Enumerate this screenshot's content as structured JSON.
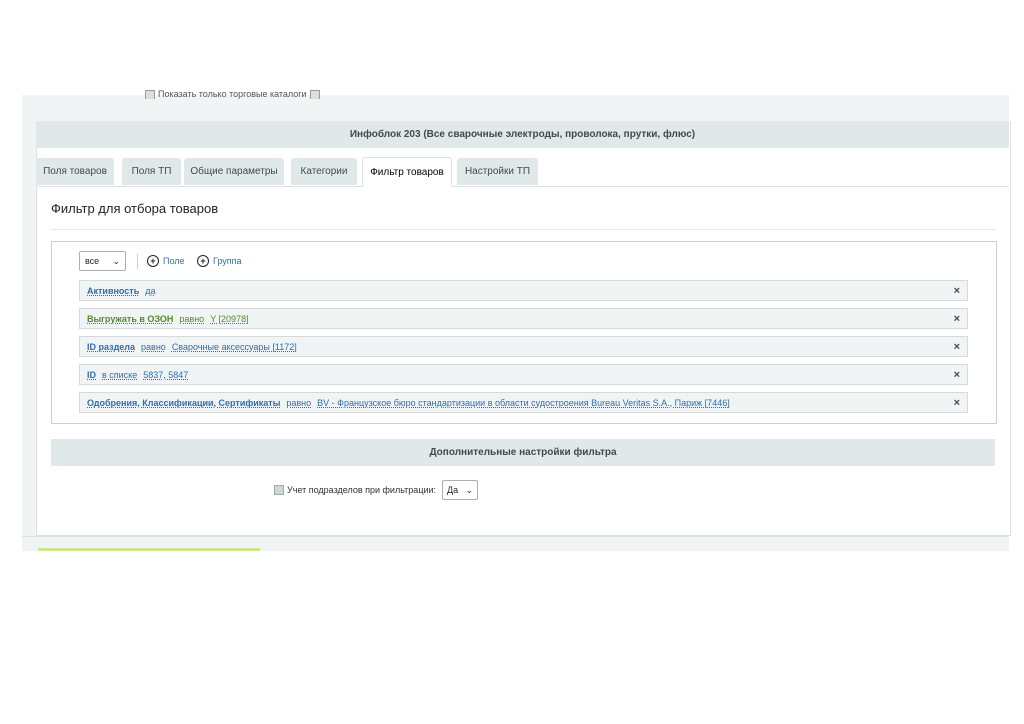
{
  "top_note": {
    "text": "Показать только торговые каталоги"
  },
  "iblock_header": "Инфоблок 203 (Все сварочные электроды, проволока, прутки, флюс)",
  "tabs": [
    {
      "label": "Поля товаров"
    },
    {
      "label": "Поля ТП"
    },
    {
      "label": "Общие параметры"
    },
    {
      "label": "Категории"
    },
    {
      "label": "Фильтр товаров",
      "active": true
    },
    {
      "label": "Настройки ТП"
    }
  ],
  "page_title": "Фильтр для отбора товаров",
  "filter": {
    "logic_value": "все",
    "add_field": "Поле",
    "add_group": "Группа",
    "conditions": [
      {
        "field": "Активность",
        "op": "",
        "value": "да",
        "color": "blue"
      },
      {
        "field": "Выгружать в ОЗОН",
        "op": "равно",
        "value": "Y [20978]",
        "color": "green"
      },
      {
        "field": "ID раздела",
        "op": "равно",
        "value": "Сварочные аксессуары [1172]",
        "color": "blue"
      },
      {
        "field": "ID",
        "op": "в списке",
        "value": "5837, 5847",
        "color": "blue"
      },
      {
        "field": "Одобрения, Классификации, Сертификаты",
        "op": "равно",
        "value": "BV - Французское бюро стандартизации в области судостроения Bureau Veritas S.A., Париж [7446]",
        "color": "blue"
      }
    ],
    "delete_glyph": "×"
  },
  "extra": {
    "header": "Дополнительные настройки фильтра",
    "subsections_label": "Учет подразделов при фильтрации:",
    "subsections_value": "Да"
  },
  "colors": {
    "link": "#2a6fb6",
    "green_link": "#4e8c2a",
    "header_bg": "#e0e8ea"
  }
}
